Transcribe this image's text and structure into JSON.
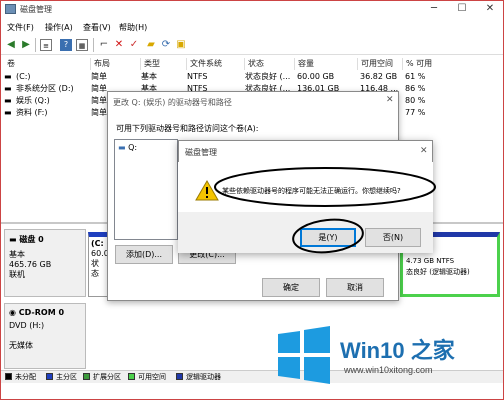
{
  "window": {
    "title": "磁盘管理"
  },
  "menu": [
    "文件(F)",
    "操作(A)",
    "查看(V)",
    "帮助(H)"
  ],
  "table": {
    "headers": [
      "卷",
      "布局",
      "类型",
      "文件系统",
      "状态",
      "容量",
      "可用空间",
      "% 可用"
    ],
    "rows": [
      [
        "(C:)",
        "简单",
        "基本",
        "NTFS",
        "状态良好 (...",
        "60.00 GB",
        "36.82 GB",
        "61 %"
      ],
      [
        "非系统分区 (D:)",
        "简单",
        "基本",
        "NTFS",
        "状态良好 (...",
        "136.01 GB",
        "116.48 ...",
        "86 %"
      ],
      [
        "娱乐 (Q:)",
        "简单",
        "",
        "",
        "",
        "",
        "",
        "80 %"
      ],
      [
        "资料 (F:)",
        "简单",
        "",
        "",
        "",
        "",
        "",
        "77 %"
      ]
    ]
  },
  "disks": {
    "disk0": {
      "name": "磁盘 0",
      "type": "基本",
      "size": "465.76 GB",
      "status": "联机",
      "part_c_label": "(C:",
      "part_c_size": "60.0",
      "part_c_status": "状态",
      "part_right_size": "4.73 GB NTFS",
      "part_right_status": "态良好 (逻辑驱动器)"
    },
    "cdrom": {
      "name": "CD-ROM 0",
      "type": "DVD (H:)",
      "status": "无媒体"
    }
  },
  "legend": [
    {
      "label": "未分配",
      "color": "#000000"
    },
    {
      "label": "主分区",
      "color": "#1f3fbf"
    },
    {
      "label": "扩展分区",
      "color": "#3c9a3c"
    },
    {
      "label": "可用空间",
      "color": "#4cd14c"
    },
    {
      "label": "逻辑驱动器",
      "color": "#2038a8"
    }
  ],
  "dialog_paths": {
    "title": "更改 Q: (娱乐) 的驱动器号和路径",
    "instruction": "可用下列驱动器号和路径访问这个卷(A):",
    "list_item": "Q:",
    "add_label": "添加(D)...",
    "change_label": "更改(C)...",
    "ok_label": "确定",
    "cancel_label": "取消"
  },
  "dialog_confirm": {
    "title": "磁盘管理",
    "message": "某些依赖驱动器号的程序可能无法正确运行。你想继续吗?",
    "yes_label": "是(Y)",
    "no_label": "否(N)"
  },
  "watermark": {
    "brand": "Win10 之家",
    "url": "www.win10xitong.com"
  }
}
